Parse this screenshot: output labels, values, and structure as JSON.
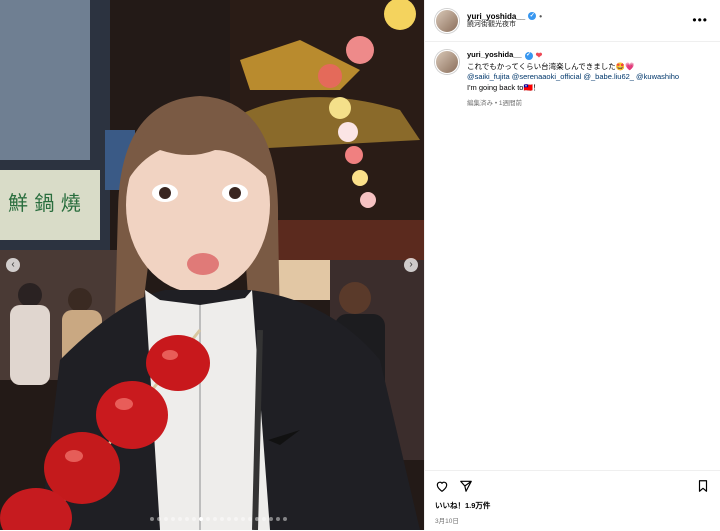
{
  "post": {
    "username": "yuri_yoshida__",
    "location": "饒河街觀光夜市",
    "more_icon": "more-horizontal-icon",
    "caption_line1": "これでもかってくらい台湾楽しんできました🤩💗",
    "mentions": "@saiki_fujita @serenaaoki_official @_babe.liu62_ @kuwashiho",
    "caption_line3": "I'm going back to🇹🇼！",
    "edited": "編集済み",
    "ago": "1週間前",
    "likes": "いいね！1.9万件",
    "date": "3月10日",
    "carousel_current": 8,
    "carousel_total": 20
  },
  "photo_sign_text": "鮮 鍋 燒",
  "colors": {
    "accent": "#3897f0",
    "heart": "#ed4956",
    "link": "#00376b"
  }
}
